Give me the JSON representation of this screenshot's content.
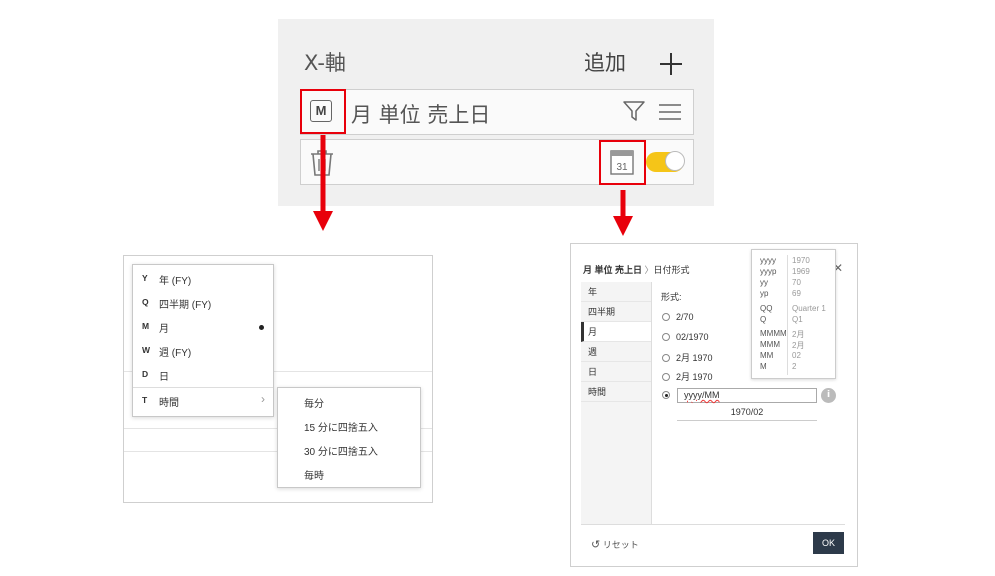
{
  "top_panel": {
    "axis_title": "X-軸",
    "add_label": "追加",
    "unit_badge": "M",
    "field_name": "月 単位 売上日",
    "calendar_day": "31",
    "toggle_on": true
  },
  "colors": {
    "highlight": "#e8000b",
    "toggle": "#f5c518",
    "ok_button": "#2d3a4a"
  },
  "time_menu": {
    "items": [
      {
        "key": "Y",
        "label": "年 (FY)",
        "selected": false
      },
      {
        "key": "Q",
        "label": "四半期 (FY)",
        "selected": false
      },
      {
        "key": "M",
        "label": "月",
        "selected": true
      },
      {
        "key": "W",
        "label": "週 (FY)",
        "selected": false
      },
      {
        "key": "D",
        "label": "日",
        "selected": false
      },
      {
        "key": "T",
        "label": "時間",
        "selected": false,
        "has_submenu": true
      }
    ],
    "submenu": [
      "毎分",
      "15 分に四捨五入",
      "30 分に四捨五入",
      "毎時"
    ]
  },
  "date_dialog": {
    "breadcrumb_field": "月 単位 売上日",
    "breadcrumb_page": "日付形式",
    "nav": [
      "年",
      "四半期",
      "月",
      "週",
      "日",
      "時間"
    ],
    "active_nav": "月",
    "format_label": "形式:",
    "options": [
      "2/70",
      "02/1970",
      "2月 1970",
      "2月 1970"
    ],
    "custom_format": "yyyy/MM",
    "preview": "1970/02",
    "reset_label": "リセット",
    "ok_label": "OK",
    "tooltip": [
      {
        "code": "yyyy",
        "value": "1970"
      },
      {
        "code": "yyyp",
        "value": "1969"
      },
      {
        "code": "yy",
        "value": "70"
      },
      {
        "code": "yp",
        "value": "69"
      },
      {
        "code": "QQ",
        "value": "Quarter 1"
      },
      {
        "code": "Q",
        "value": "Q1"
      },
      {
        "code": "MMMM",
        "value": "2月"
      },
      {
        "code": "MMM",
        "value": "2月"
      },
      {
        "code": "MM",
        "value": "02"
      },
      {
        "code": "M",
        "value": "2"
      }
    ]
  }
}
